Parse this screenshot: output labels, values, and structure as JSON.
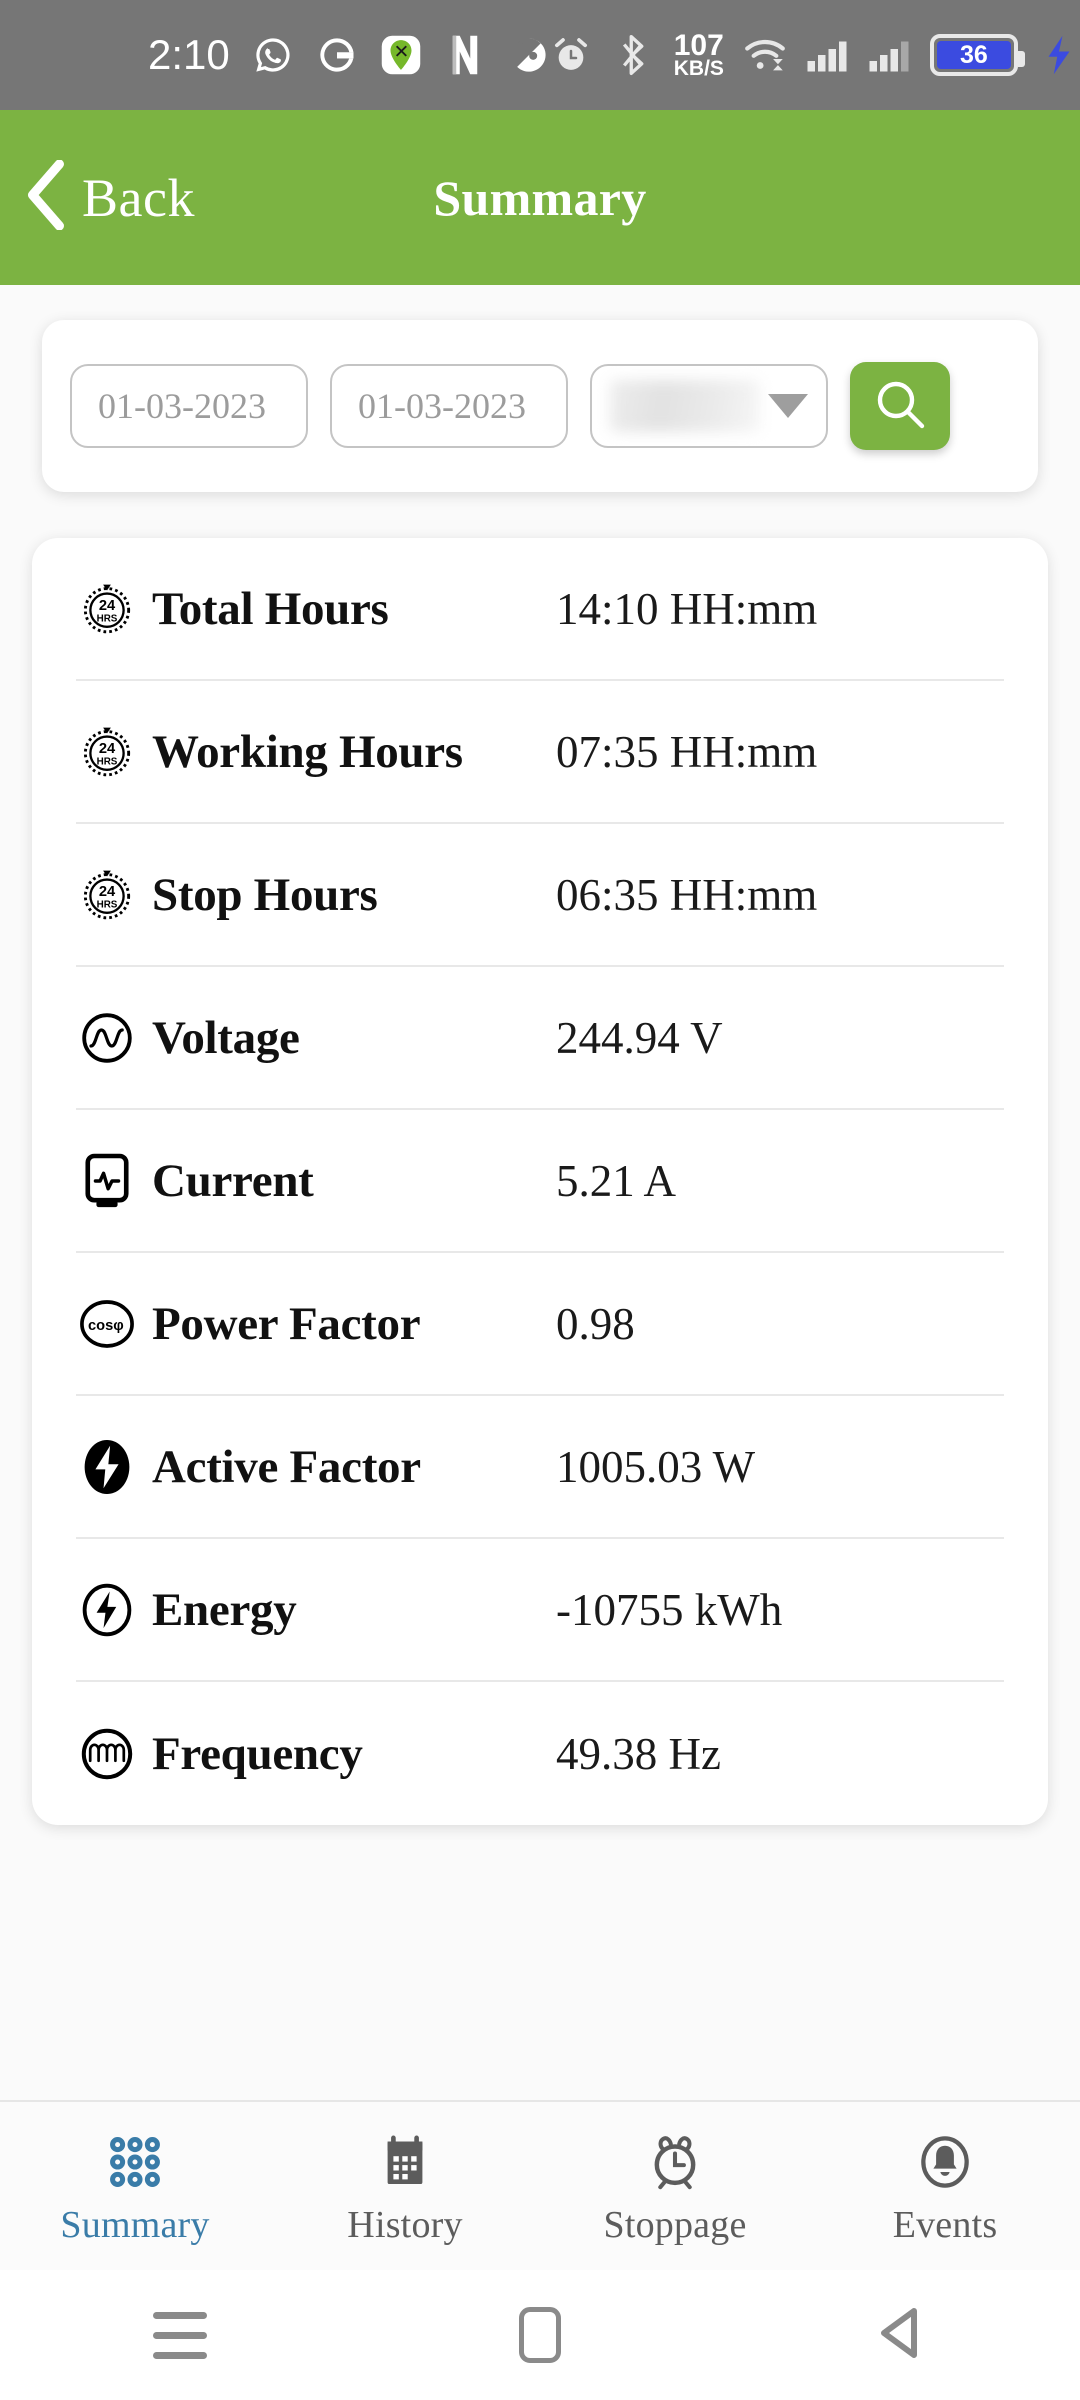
{
  "status_bar": {
    "time": "2:10",
    "network_speed_value": "107",
    "network_speed_unit": "KB/S",
    "battery_percent": "36",
    "left_icons": [
      "whatsapp-icon",
      "google-icon",
      "green-pin-app-icon",
      "netflix-icon",
      "media-disc-icon"
    ],
    "right_icons": [
      "alarm-icon",
      "bluetooth-icon",
      "wifi-icon",
      "signal-1-icon",
      "signal-2-icon",
      "battery-icon",
      "charging-bolt-icon"
    ],
    "background_color": "#767676",
    "battery_fill_color": "#3B4BE0"
  },
  "app_bar": {
    "back_label": "Back",
    "title": "Summary",
    "background_color": "#7CB342"
  },
  "filter": {
    "from_date": "01-03-2023",
    "to_date": "01-03-2023",
    "device_select_value": "",
    "device_select_redacted": true,
    "search_button_label": "search-icon",
    "search_button_color": "#7CB342"
  },
  "summary_rows": [
    {
      "icon": "24hrs-clock-icon",
      "label": "Total Hours",
      "value": "14:10 HH:mm"
    },
    {
      "icon": "24hrs-clock-icon",
      "label": "Working Hours",
      "value": "07:35 HH:mm"
    },
    {
      "icon": "24hrs-clock-icon",
      "label": "Stop Hours",
      "value": "06:35 HH:mm"
    },
    {
      "icon": "sine-wave-circle-icon",
      "label": "Voltage",
      "value": "244.94 V"
    },
    {
      "icon": "current-meter-icon",
      "label": "Current",
      "value": "5.21 A"
    },
    {
      "icon": "cos-phi-icon",
      "label": "Power Factor",
      "value": "0.98"
    },
    {
      "icon": "filled-bolt-icon",
      "label": "Active Factor",
      "value": "1005.03 W"
    },
    {
      "icon": "bolt-circle-icon",
      "label": "Energy",
      "value": "-10755 kWh"
    },
    {
      "icon": "frequency-wave-icon",
      "label": "Frequency",
      "value": "49.38 Hz"
    }
  ],
  "bottom_nav": {
    "active_color": "#3A7CA8",
    "inactive_color": "#5C5C5C",
    "items": [
      {
        "label": "Summary",
        "icon": "grid-dots-icon",
        "active": true
      },
      {
        "label": "History",
        "icon": "calendar-icon",
        "active": false
      },
      {
        "label": "Stoppage",
        "icon": "alarm-clock-icon",
        "active": false
      },
      {
        "label": "Events",
        "icon": "bell-circle-icon",
        "active": false
      }
    ]
  },
  "android_nav": {
    "recents": "recents-icon",
    "home": "home-icon",
    "back": "back-triangle-icon"
  }
}
